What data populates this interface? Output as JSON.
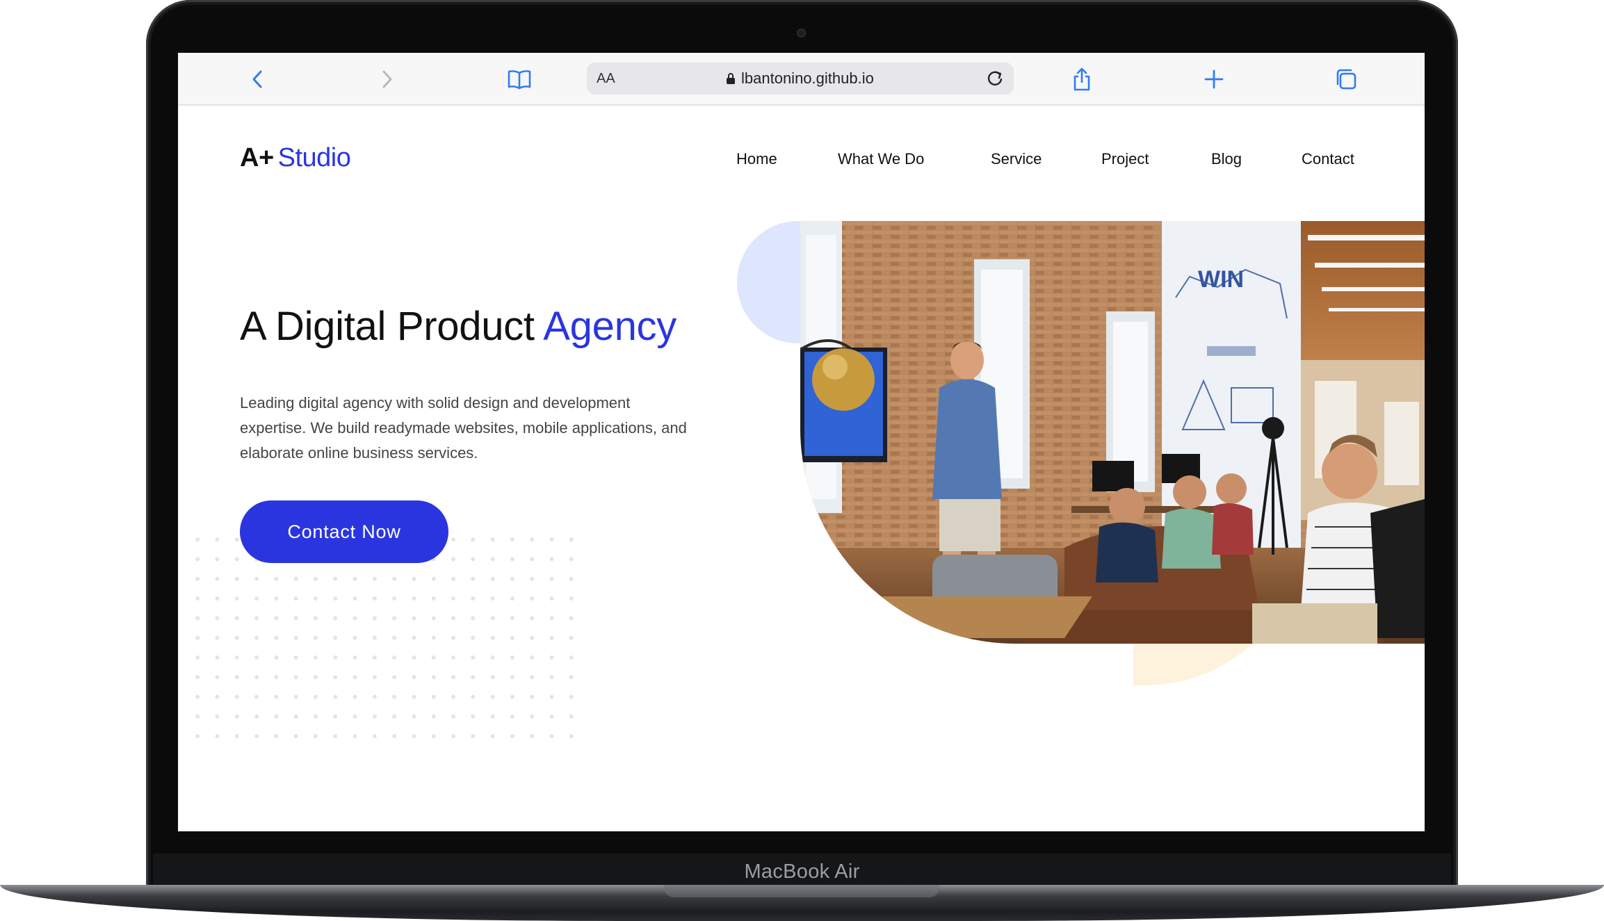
{
  "device": {
    "model_label": "MacBook Air"
  },
  "browser": {
    "address_bar": {
      "text_size_label": "AA",
      "url": "lbantonino.github.io"
    },
    "icons": [
      "chevron-left-icon",
      "chevron-right-icon",
      "bookmarks-book-icon",
      "lock-icon",
      "reload-icon",
      "share-icon",
      "plus-icon",
      "tabs-icon"
    ]
  },
  "site": {
    "logo": {
      "prefix": "A+",
      "name": "Studio"
    },
    "nav": [
      {
        "label": "Home"
      },
      {
        "label": "What We Do"
      },
      {
        "label": "Service"
      },
      {
        "label": "Project"
      },
      {
        "label": "Blog"
      },
      {
        "label": "Contact"
      }
    ],
    "hero": {
      "headline_prefix": "A Digital Product",
      "headline_accent": "Agency",
      "description": "Leading digital agency with solid design and development expertise. We build readymade websites, mobile applications, and elaborate online business services.",
      "cta_label": "Contact Now",
      "image_wall_text": "WIN"
    }
  },
  "colors": {
    "accent": "#2a35e0",
    "blob_blue": "#dde6fd",
    "blob_yellow": "#fdf2dc",
    "toolbar_bg": "#f7f7f8"
  }
}
